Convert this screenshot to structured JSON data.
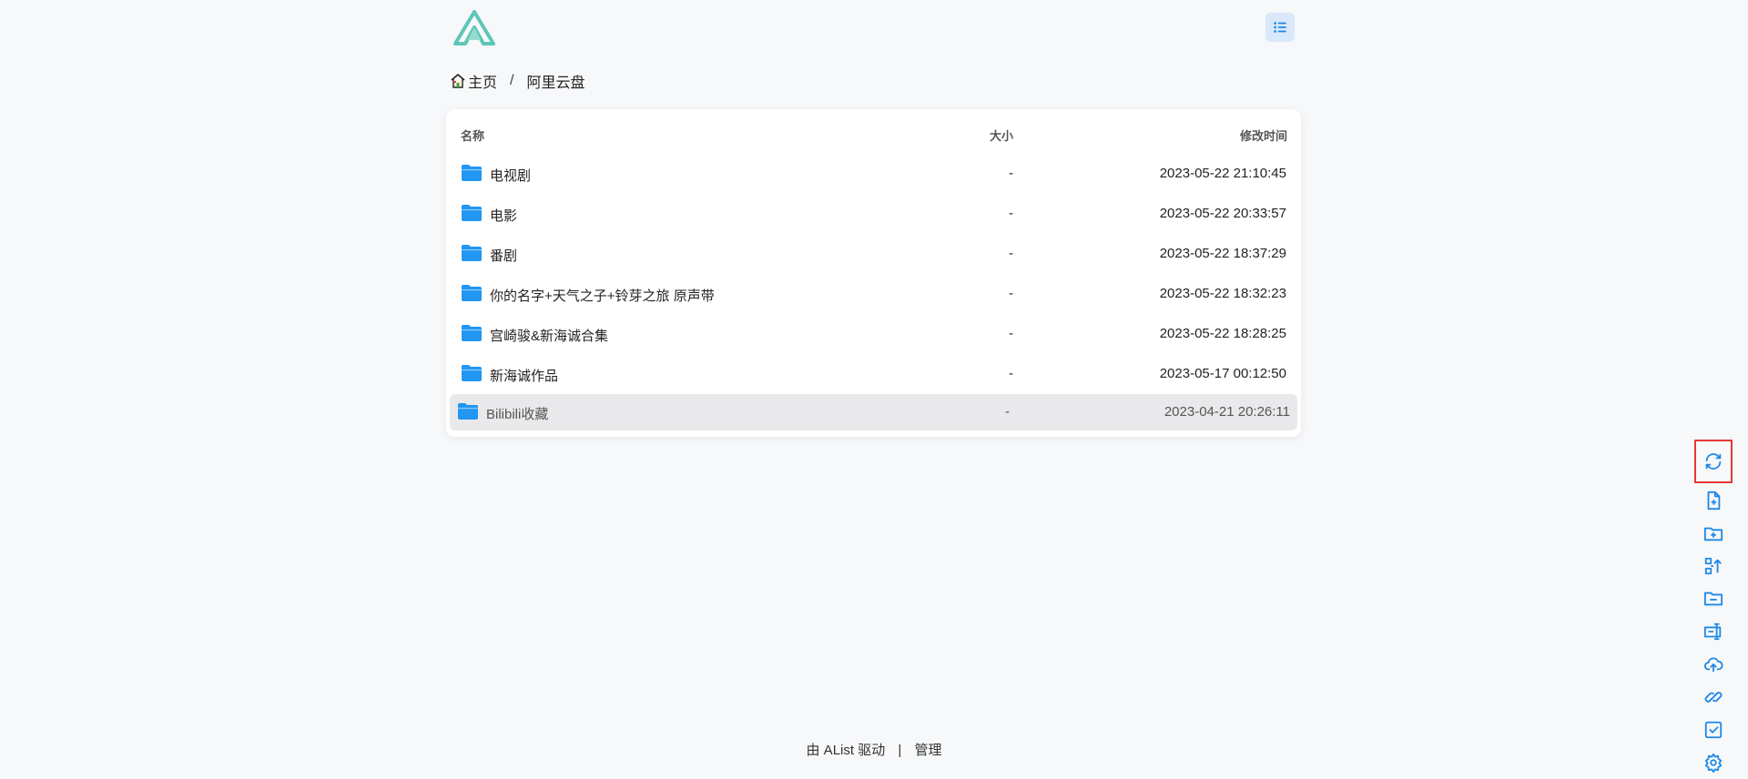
{
  "breadcrumb": {
    "home": "主页",
    "separator": "/",
    "current": "阿里云盘"
  },
  "table": {
    "headers": {
      "name": "名称",
      "size": "大小",
      "modified": "修改时间"
    },
    "rows": [
      {
        "name": "电视剧",
        "size": "-",
        "modified": "2023-05-22 21:10:45"
      },
      {
        "name": "电影",
        "size": "-",
        "modified": "2023-05-22 20:33:57"
      },
      {
        "name": "番剧",
        "size": "-",
        "modified": "2023-05-22 18:37:29"
      },
      {
        "name": "你的名字+天气之子+铃芽之旅 原声带",
        "size": "-",
        "modified": "2023-05-22 18:32:23"
      },
      {
        "name": "宫崎骏&新海诚合集",
        "size": "-",
        "modified": "2023-05-22 18:28:25"
      },
      {
        "name": "新海诚作品",
        "size": "-",
        "modified": "2023-05-17 00:12:50"
      },
      {
        "name": "Bilibili收藏",
        "size": "-",
        "modified": "2023-04-21 20:26:11"
      }
    ]
  },
  "footer": {
    "powered": "由 AList 驱动",
    "separator": "|",
    "manage": "管理"
  },
  "toolbar_icons": [
    "refresh-icon",
    "new-file-icon",
    "new-folder-icon",
    "recursive-move-icon",
    "remove-empty-folder-icon",
    "batch-rename-icon",
    "upload-icon",
    "offline-download-icon",
    "select-icon",
    "settings-icon"
  ],
  "colors": {
    "accent": "#1e88e5",
    "folder": "#2196f3",
    "highlight_box": "#e53935",
    "logo": "#5ec6b7",
    "row_hover": "#e9e9ec"
  }
}
